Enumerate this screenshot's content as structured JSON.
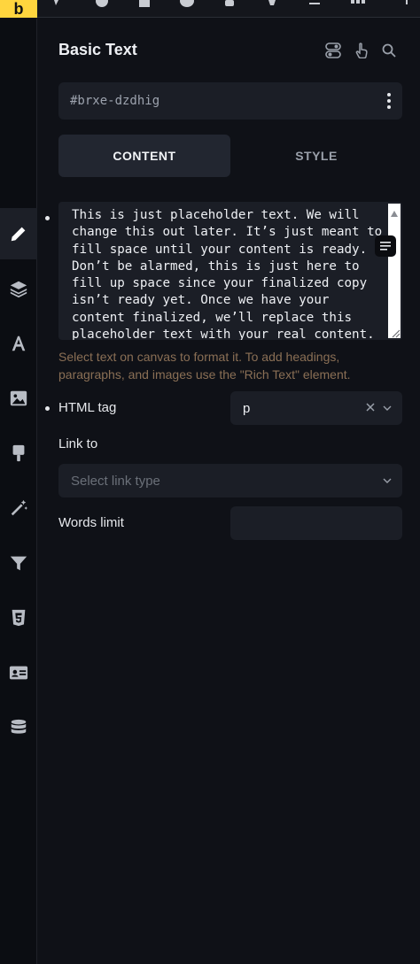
{
  "app": {
    "logo_letter": "b"
  },
  "panel": {
    "title": "Basic Text",
    "element_id": "#brxe-dzdhig"
  },
  "tabs": [
    {
      "label": "CONTENT",
      "active": true
    },
    {
      "label": "STYLE",
      "active": false
    }
  ],
  "text_field": {
    "value": "This is just placeholder text. We will change this out later. It’s just meant to fill space until your content is ready. Don’t be alarmed, this is just here to fill up space since your finalized copy isn’t ready yet. Once we have your content finalized, we’ll replace this placeholder text with your real content.",
    "hint": "Select text on canvas to format it. To add headings, paragraphs, and images use the \"Rich Text\" element."
  },
  "html_tag": {
    "label": "HTML tag",
    "value": "p"
  },
  "link_to": {
    "label": "Link to",
    "placeholder": "Select link type"
  },
  "words_limit": {
    "label": "Words limit",
    "value": ""
  },
  "colors": {
    "accent": "#ffd53e",
    "background": "#0f1117",
    "field": "#1b1e26",
    "hint": "#8a6f55"
  },
  "rail_icons": [
    "pencil-icon",
    "layers-icon",
    "typography-icon",
    "image-icon",
    "brush-icon",
    "magic-wand-icon",
    "filter-icon",
    "css3-icon",
    "id-card-icon",
    "database-icon"
  ]
}
